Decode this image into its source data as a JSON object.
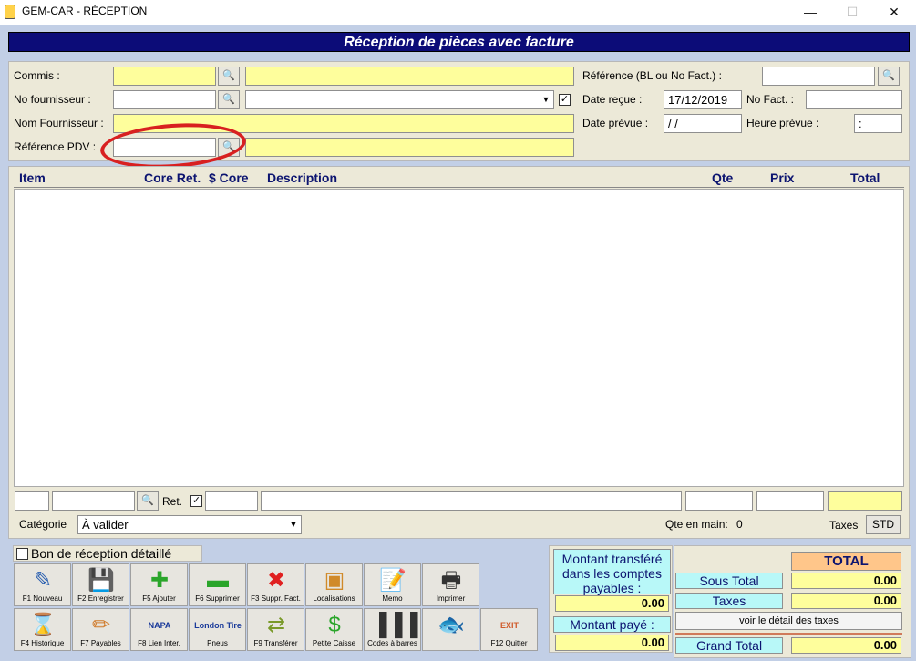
{
  "window": {
    "title": "GEM-CAR - RÉCEPTION",
    "min": "—",
    "max": "☐",
    "close": "✕"
  },
  "header": {
    "title": "Réception de pièces avec facture"
  },
  "form": {
    "commis_label": "Commis :",
    "commis_value": "",
    "commis_desc": "",
    "no_fournisseur_label": "No fournisseur :",
    "no_fournisseur_value": "",
    "no_fournisseur_combo": "",
    "no_fournisseur_checked": "✓",
    "nom_fournisseur_label": "Nom Fournisseur :",
    "nom_fournisseur_value": "",
    "reference_pdv_label": "Référence PDV :",
    "reference_pdv_value": "",
    "reference_pdv_desc": "",
    "reference_label": "Référence (BL ou No Fact.) :",
    "reference_value": "",
    "date_recue_label": "Date reçue :",
    "date_recue_value": "17/12/2019",
    "no_fact_label": "No Fact. :",
    "no_fact_value": "",
    "date_prevue_label": "Date prévue :",
    "date_prevue_value": " / /",
    "heure_prevue_label": "Heure prévue :",
    "heure_prevue_value": ":"
  },
  "grid": {
    "columns": [
      "Item",
      "Core Ret.",
      "$ Core",
      "Description",
      "Qte",
      "Prix",
      "Total"
    ]
  },
  "entry": {
    "ret_label": "Ret.",
    "ret_checked": "✓"
  },
  "categorie": {
    "label": "Catégorie",
    "value": "À valider"
  },
  "qte_en_main": {
    "label": "Qte en main:",
    "value": "0"
  },
  "taxes": {
    "label": "Taxes",
    "button": "STD"
  },
  "bon_reception": {
    "label": "Bon de réception détaillé"
  },
  "toolbar_row1": [
    {
      "name": "nouveau",
      "caption": "F1 Nouveau",
      "icon": "notebook-pen-icon",
      "glyph": "✎",
      "color": "#2a5fb0"
    },
    {
      "name": "enregistrer",
      "caption": "F2 Enregistrer",
      "icon": "floppy-disk-icon",
      "glyph": "💾",
      "color": "#6a6a9a"
    },
    {
      "name": "ajouter",
      "caption": "F5 Ajouter",
      "icon": "plus-icon",
      "glyph": "✚",
      "color": "#2aa52a"
    },
    {
      "name": "supprimer",
      "caption": "F6 Supprimer",
      "icon": "minus-icon",
      "glyph": "▬",
      "color": "#2aa52a"
    },
    {
      "name": "suppr-fact",
      "caption": "F3 Suppr. Fact.",
      "icon": "red-x-icon",
      "glyph": "✖",
      "color": "#e02020"
    },
    {
      "name": "localisations",
      "caption": "Localisations",
      "icon": "box-icon",
      "glyph": "▣",
      "color": "#d08a2a"
    },
    {
      "name": "memo",
      "caption": "Memo",
      "icon": "memo-icon",
      "glyph": "📝",
      "color": "#4a6aa0"
    },
    {
      "name": "imprimer",
      "caption": "Imprimer",
      "icon": "printer-icon",
      "glyph": "🖶",
      "color": "#333"
    }
  ],
  "toolbar_row2": [
    {
      "name": "historique",
      "caption": "F4 Historique",
      "icon": "hourglass-icon",
      "glyph": "⌛",
      "color": "#2a5fb0"
    },
    {
      "name": "payables",
      "caption": "F7 Payables",
      "icon": "pencil-paper-icon",
      "glyph": "✏",
      "color": "#d07a2a"
    },
    {
      "name": "lien-inter",
      "caption": "F8 Lien Inter.",
      "icon": "napa-logo-icon",
      "glyph": "NAPA",
      "color": "#1a3a9a"
    },
    {
      "name": "pneus",
      "caption": "Pneus",
      "icon": "london-tire-logo-icon",
      "glyph": "London Tire",
      "color": "#1a3a9a"
    },
    {
      "name": "transferer",
      "caption": "F9 Transférer",
      "icon": "transfer-icon",
      "glyph": "⇄",
      "color": "#7a9a2a"
    },
    {
      "name": "petite-caisse",
      "caption": "Petite Caisse",
      "icon": "dollar-icon",
      "glyph": "$",
      "color": "#2aa52a"
    },
    {
      "name": "codes-barres",
      "caption": "Codes à barres",
      "icon": "barcode-icon",
      "glyph": "▌▌▌",
      "color": "#333"
    },
    {
      "name": "fish",
      "caption": "",
      "icon": "fish-icon",
      "glyph": "🐟",
      "color": "#9a9a9a"
    },
    {
      "name": "quitter",
      "caption": "F12 Quitter",
      "icon": "exit-door-icon",
      "glyph": "EXIT",
      "color": "#d05a2a"
    }
  ],
  "montant_transfere": {
    "label": "Montant transféré dans les comptes payables :",
    "value": "0.00"
  },
  "montant_paye": {
    "label": "Montant payé :",
    "value": "0.00"
  },
  "totals": {
    "title": "TOTAL",
    "sous_total_label": "Sous Total",
    "sous_total_value": "0.00",
    "taxes_label": "Taxes",
    "taxes_value": "0.00",
    "detail_button": "voir le détail des taxes",
    "grand_total_label": "Grand Total",
    "grand_total_value": "0.00"
  }
}
